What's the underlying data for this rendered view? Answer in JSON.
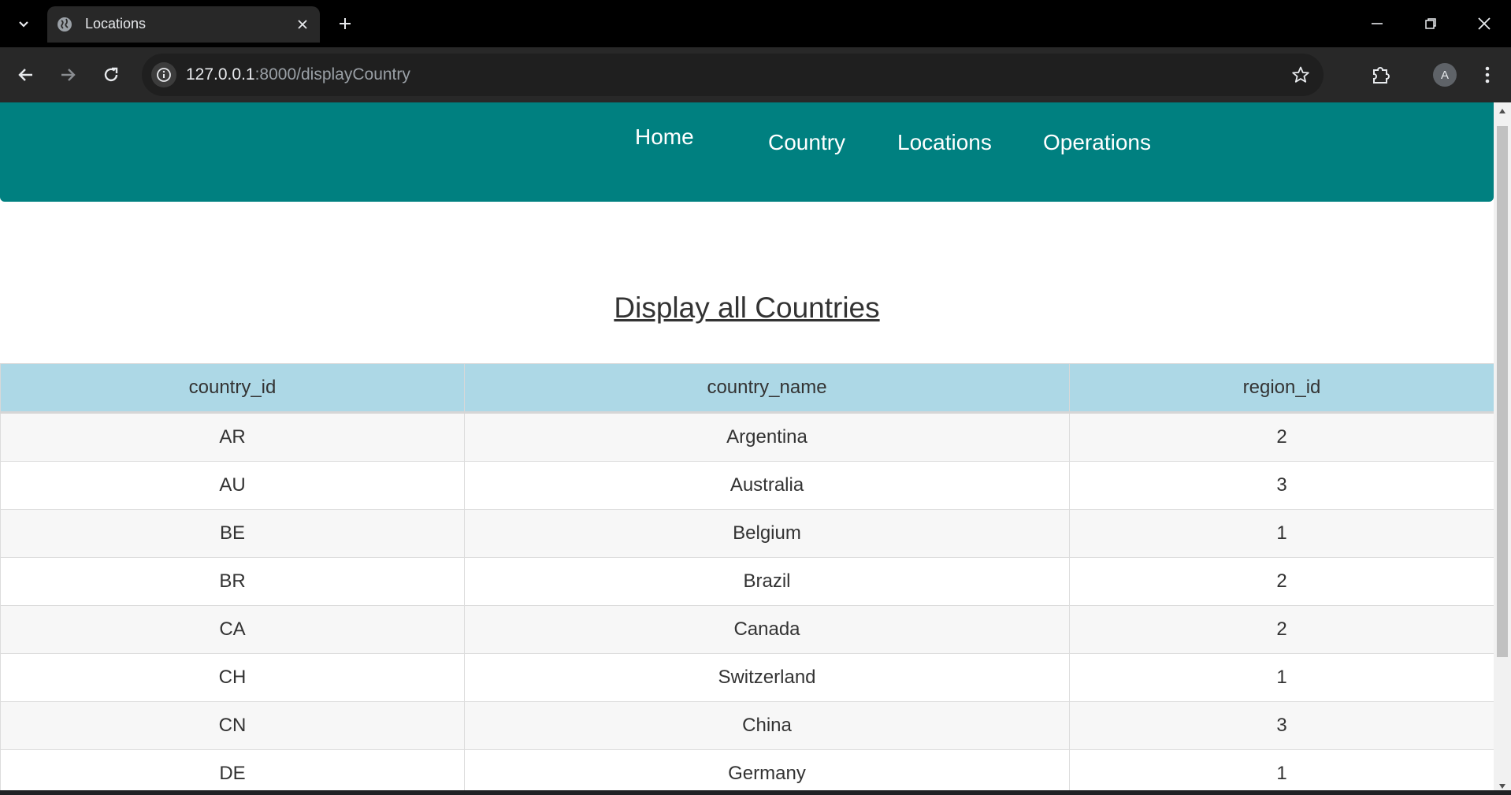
{
  "browser": {
    "tab": {
      "title": "Locations",
      "favicon": "globe-icon"
    },
    "url": {
      "host": "127.0.0.1",
      "rest": ":8000/displayCountry"
    },
    "profile_initial": "A",
    "icons": {
      "tab_menu": "chevron-down-icon",
      "close_tab": "close-icon",
      "new_tab": "plus-icon",
      "back": "arrow-left-icon",
      "forward": "arrow-right-icon",
      "reload": "reload-icon",
      "site_info": "info-icon",
      "bookmark": "star-icon",
      "extensions": "puzzle-icon",
      "menu": "kebab-menu-icon",
      "minimize": "minimize-icon",
      "restore": "restore-icon",
      "close_window": "close-icon"
    }
  },
  "nav": {
    "home": "Home",
    "country": "Country",
    "locations": "Locations",
    "operations": "Operations"
  },
  "page": {
    "title": "Display all Countries"
  },
  "table": {
    "columns": [
      "country_id",
      "country_name",
      "region_id"
    ],
    "rows": [
      [
        "AR",
        "Argentina",
        "2"
      ],
      [
        "AU",
        "Australia",
        "3"
      ],
      [
        "BE",
        "Belgium",
        "1"
      ],
      [
        "BR",
        "Brazil",
        "2"
      ],
      [
        "CA",
        "Canada",
        "2"
      ],
      [
        "CH",
        "Switzerland",
        "1"
      ],
      [
        "CN",
        "China",
        "3"
      ],
      [
        "DE",
        "Germany",
        "1"
      ]
    ]
  },
  "colors": {
    "navbar": "#008080",
    "table_header": "#add8e6"
  }
}
